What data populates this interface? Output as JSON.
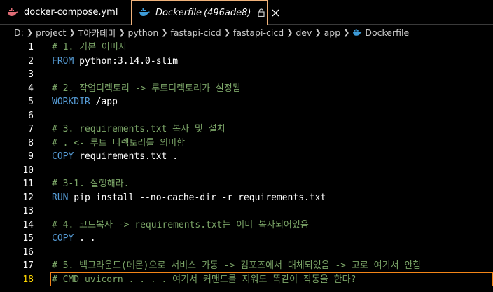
{
  "tabs": [
    {
      "label": "docker-compose.yml",
      "active": false
    },
    {
      "label": "Dockerfile",
      "hash": "(496ade8)",
      "active": true
    }
  ],
  "breadcrumb": [
    "D:",
    "project",
    "T아카데미",
    "python",
    "fastapi-cicd",
    "fastapi-cicd",
    "dev",
    "app",
    "Dockerfile"
  ],
  "colors": {
    "comment": "#7ca668",
    "keyword": "#569cd6",
    "active_border": "#f38518",
    "active_line_number": "#ffd700",
    "docker_blue": "#3d9bd8"
  },
  "icons": {
    "file": "docker-whale-icon",
    "lock": "lock-icon",
    "close": "close-icon",
    "separator": "chevron-right-icon"
  },
  "editor": {
    "active_line": 18,
    "lines": [
      {
        "n": "1",
        "parts": [
          {
            "t": "# 1. 기본 이미지",
            "c": "cmt"
          }
        ]
      },
      {
        "n": "2",
        "parts": [
          {
            "t": "FROM",
            "c": "kw"
          },
          {
            "t": " python:3.14.0-slim",
            "c": ""
          }
        ]
      },
      {
        "n": "3",
        "parts": []
      },
      {
        "n": "4",
        "parts": [
          {
            "t": "# 2. 작업디렉토리 -> 루트디렉토리가 설정됨",
            "c": "cmt"
          }
        ]
      },
      {
        "n": "5",
        "parts": [
          {
            "t": "WORKDIR",
            "c": "kw"
          },
          {
            "t": " /app",
            "c": ""
          }
        ]
      },
      {
        "n": "6",
        "parts": []
      },
      {
        "n": "7",
        "parts": [
          {
            "t": "# 3. requirements.txt 복사 및 설치",
            "c": "cmt"
          }
        ]
      },
      {
        "n": "8",
        "parts": [
          {
            "t": "# . <- 루트 디렉토리를 의미함",
            "c": "cmt"
          }
        ]
      },
      {
        "n": "9",
        "parts": [
          {
            "t": "COPY",
            "c": "kw"
          },
          {
            "t": " requirements.txt .",
            "c": ""
          }
        ]
      },
      {
        "n": "10",
        "parts": []
      },
      {
        "n": "11",
        "parts": [
          {
            "t": "# 3-1. 실행해라.",
            "c": "cmt"
          }
        ]
      },
      {
        "n": "12",
        "parts": [
          {
            "t": "RUN",
            "c": "kw"
          },
          {
            "t": " pip install --no-cache-dir -r requirements.txt",
            "c": ""
          }
        ]
      },
      {
        "n": "13",
        "parts": []
      },
      {
        "n": "14",
        "parts": [
          {
            "t": "# 4. 코드복사 -> requirements.txt는 이미 복사되어있음",
            "c": "cmt"
          }
        ]
      },
      {
        "n": "15",
        "parts": [
          {
            "t": "COPY",
            "c": "kw"
          },
          {
            "t": " . .",
            "c": ""
          }
        ]
      },
      {
        "n": "16",
        "parts": []
      },
      {
        "n": "17",
        "parts": [
          {
            "t": "# 5. 백그라운드(데몬)으로 서비스 가동 -> 컴포즈에서 대체되었음 -> 고로 여기서 안함",
            "c": "cmt"
          }
        ]
      },
      {
        "n": "18",
        "parts": [
          {
            "t": "# CMD uvicorn . . . . 여기서 커맨드를 지워도 똑같이 작동을 한다?",
            "c": "cmt"
          }
        ]
      }
    ]
  }
}
